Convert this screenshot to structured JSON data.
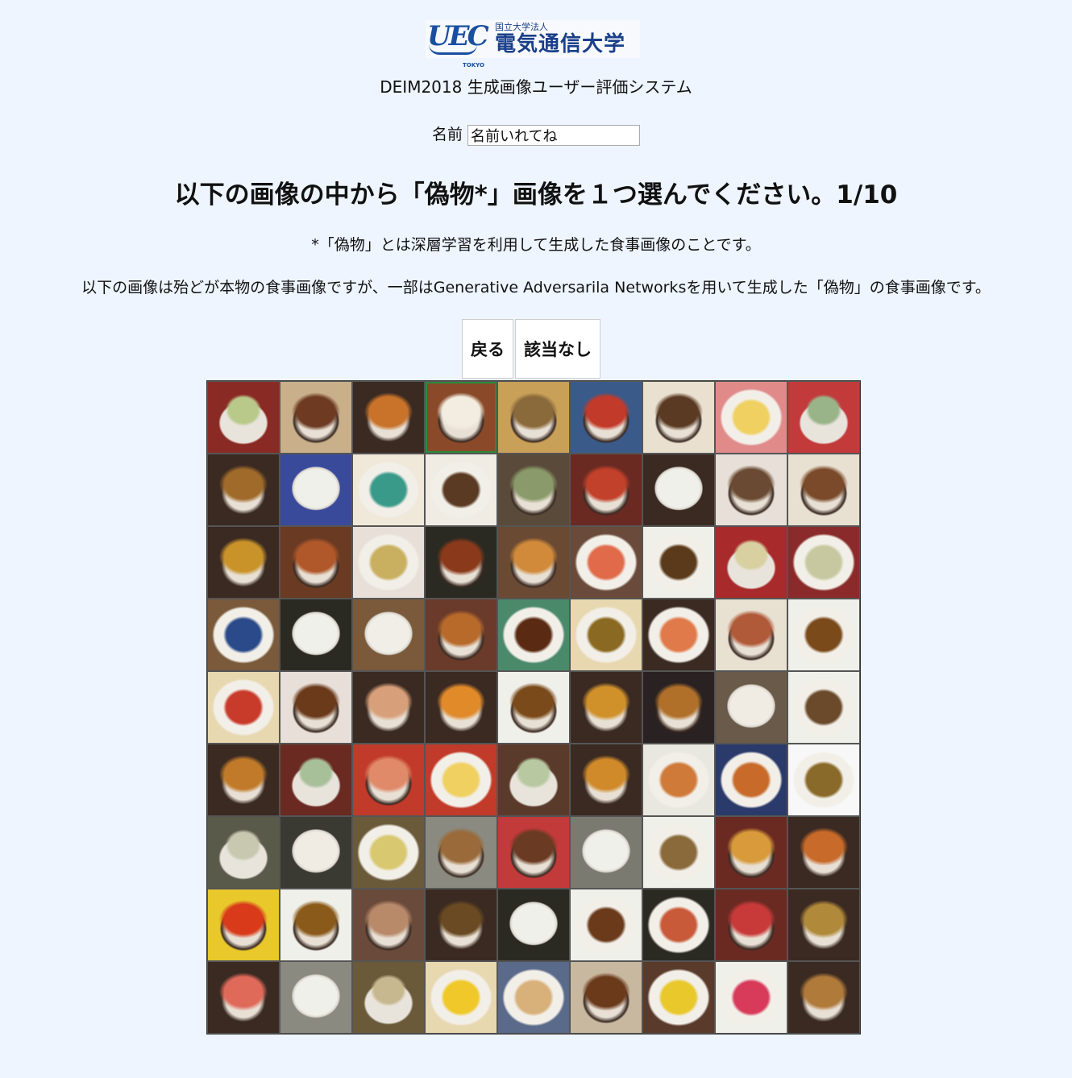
{
  "logo": {
    "mark": "UEC",
    "mark_sub": "TOKYO",
    "small": "国立大学法人",
    "big": "電気通信大学"
  },
  "system_title": "DEIM2018 生成画像ユーザー評価システム",
  "name_label": "名前",
  "name_value": "名前いれてね",
  "heading": "以下の画像の中から「偽物*」画像を１つ選んでください。1/10",
  "note_1": "*「偽物」とは深層学習を利用して生成した食事画像のことです。",
  "note_2": "以下の画像は殆どが本物の食事画像ですが、一部はGenerative Adversarila Networksを用いて生成した「偽物」の食事画像です。",
  "buttons": {
    "back": "戻る",
    "none": "該当なし"
  },
  "grid": {
    "rows": 9,
    "cols": 9,
    "selected_index": 3,
    "cells": [
      [
        "#b8c98a",
        "#8a2a24",
        "cabbage"
      ],
      [
        "#6e3a22",
        "#c9b08a",
        "bowl"
      ],
      [
        "#c9732a",
        "#3a2a22",
        "bowl"
      ],
      [
        "#f2ede0",
        "#8a4a2a",
        "bowl"
      ],
      [
        "#8a6a3a",
        "#c9a058",
        "bowl"
      ],
      [
        "#c23a2a",
        "#3a5a8a",
        "bowl"
      ],
      [
        "#5a3a22",
        "#e9e0d0",
        "bowl"
      ],
      [
        "#f0d060",
        "#e08a8a",
        "plate"
      ],
      [
        "#9ab48a",
        "#c23a3a",
        "cabbage"
      ],
      [
        "#a06a2a",
        "#3a2a22",
        "bowl"
      ],
      [
        "#f0f0ea",
        "#3a4a9a",
        "rice"
      ],
      [
        "#3a9a8a",
        "#f0e8d8",
        "plate"
      ],
      [
        "#5a3a22",
        "#f0ece4",
        "plate"
      ],
      [
        "#8a9a6a",
        "#5a4a3a",
        "bowl"
      ],
      [
        "#c2412a",
        "#6a2a22",
        "bowl"
      ],
      [
        "#f0f0ea",
        "#3a2a22",
        "rice"
      ],
      [
        "#6a4a32",
        "#e8e0d8",
        "bowl"
      ],
      [
        "#7a4a2a",
        "#e8e0d0",
        "bowl"
      ],
      [
        "#c9932a",
        "#3a2a22",
        "bowl"
      ],
      [
        "#b0582a",
        "#6a3a22",
        "bowl"
      ],
      [
        "#c9b060",
        "#e8e0d8",
        "plate"
      ],
      [
        "#8a3a1a",
        "#2a2a22",
        "bowl"
      ],
      [
        "#d08a3a",
        "#6a4a32",
        "bowl"
      ],
      [
        "#e06a4a",
        "#6a4a3a",
        "plate"
      ],
      [
        "#5a3a1a",
        "#f0f0ea",
        "plate"
      ],
      [
        "#d8d0a0",
        "#a82a2a",
        "cabbage"
      ],
      [
        "#c8c8a0",
        "#8a2a2a",
        "plate"
      ],
      [
        "#2a4a8a",
        "#7a5a3a",
        "plate"
      ],
      [
        "#f0f0ea",
        "#2a2a22",
        "rice"
      ],
      [
        "#f0eee6",
        "#7a5a3a",
        "rice"
      ],
      [
        "#b86a2a",
        "#6a3a2a",
        "bowl"
      ],
      [
        "#5a2a12",
        "#4a8a6a",
        "plate"
      ],
      [
        "#8a6a22",
        "#e8d8b0",
        "plate"
      ],
      [
        "#e07a4a",
        "#3a2a22",
        "plate"
      ],
      [
        "#b05a3a",
        "#e8e0d0",
        "bowl"
      ],
      [
        "#7a4a1a",
        "#f0f0ea",
        "plate"
      ],
      [
        "#c83a2a",
        "#e8d8b0",
        "plate"
      ],
      [
        "#6a3a1a",
        "#e8e0d8",
        "bowl"
      ],
      [
        "#d8a07a",
        "#3a2a22",
        "bowl"
      ],
      [
        "#e08a2a",
        "#3a2a22",
        "bowl"
      ],
      [
        "#7a4a1a",
        "#f0f0ea",
        "bowl"
      ],
      [
        "#d0902a",
        "#3a2a22",
        "bowl"
      ],
      [
        "#b0702a",
        "#2a2222",
        "bowl"
      ],
      [
        "#f0ece4",
        "#6a5a4a",
        "rice"
      ],
      [
        "#6a4a2a",
        "#f0f0ea",
        "plate"
      ],
      [
        "#c07a2a",
        "#3a2a22",
        "bowl"
      ],
      [
        "#a8c09a",
        "#6a2a22",
        "cabbage"
      ],
      [
        "#e08a6a",
        "#c23a2a",
        "bowl"
      ],
      [
        "#f0d060",
        "#c23a2a",
        "plate"
      ],
      [
        "#b8c8a0",
        "#5a3a2a",
        "cabbage"
      ],
      [
        "#d08a2a",
        "#3a2a22",
        "bowl"
      ],
      [
        "#d07a3a",
        "#e8e8e0",
        "plate"
      ],
      [
        "#c86a2a",
        "#2a3a6a",
        "plate"
      ],
      [
        "#8a6a2a",
        "#f8f8f8",
        "plate"
      ],
      [
        "#c8c8b0",
        "#5a5a4a",
        "cabbage"
      ],
      [
        "#f0ece4",
        "#3a3a32",
        "rice"
      ],
      [
        "#d8c870",
        "#6a5a3a",
        "plate"
      ],
      [
        "#9a6a3a",
        "#8a8a80",
        "bowl"
      ],
      [
        "#6a3a22",
        "#c23a3a",
        "bowl"
      ],
      [
        "#f0f0ea",
        "#7a7a70",
        "rice"
      ],
      [
        "#8a6a3a",
        "#f0f0ea",
        "plate"
      ],
      [
        "#d89a3a",
        "#6a2a22",
        "bowl"
      ],
      [
        "#c86a2a",
        "#3a2a22",
        "bowl"
      ],
      [
        "#d83a1a",
        "#e8c82a",
        "bowl"
      ],
      [
        "#8a5a1a",
        "#f0f0ea",
        "bowl"
      ],
      [
        "#b88a6a",
        "#6a4a3a",
        "bowl"
      ],
      [
        "#6a4a22",
        "#3a2a22",
        "bowl"
      ],
      [
        "#f0f0ea",
        "#2a2a22",
        "rice"
      ],
      [
        "#6a3a1a",
        "#f0f0ea",
        "plate"
      ],
      [
        "#c85a3a",
        "#2a2a22",
        "plate"
      ],
      [
        "#c83a3a",
        "#6a2a22",
        "bowl"
      ],
      [
        "#b08a3a",
        "#3a2a22",
        "bowl"
      ],
      [
        "#e06a5a",
        "#3a2a22",
        "bowl"
      ],
      [
        "#f0f0ea",
        "#8a8a80",
        "rice"
      ],
      [
        "#c8b890",
        "#6a5a3a",
        "cabbage"
      ],
      [
        "#f0c82a",
        "#e8d8b0",
        "plate"
      ],
      [
        "#d8b07a",
        "#5a6a8a",
        "plate"
      ],
      [
        "#6a3a1a",
        "#c8b8a0",
        "bowl"
      ],
      [
        "#e8c82a",
        "#5a3a2a",
        "plate"
      ],
      [
        "#d83a5a",
        "#f0f0ea",
        "plate"
      ],
      [
        "#b07a3a",
        "#3a2a22",
        "bowl"
      ]
    ]
  }
}
